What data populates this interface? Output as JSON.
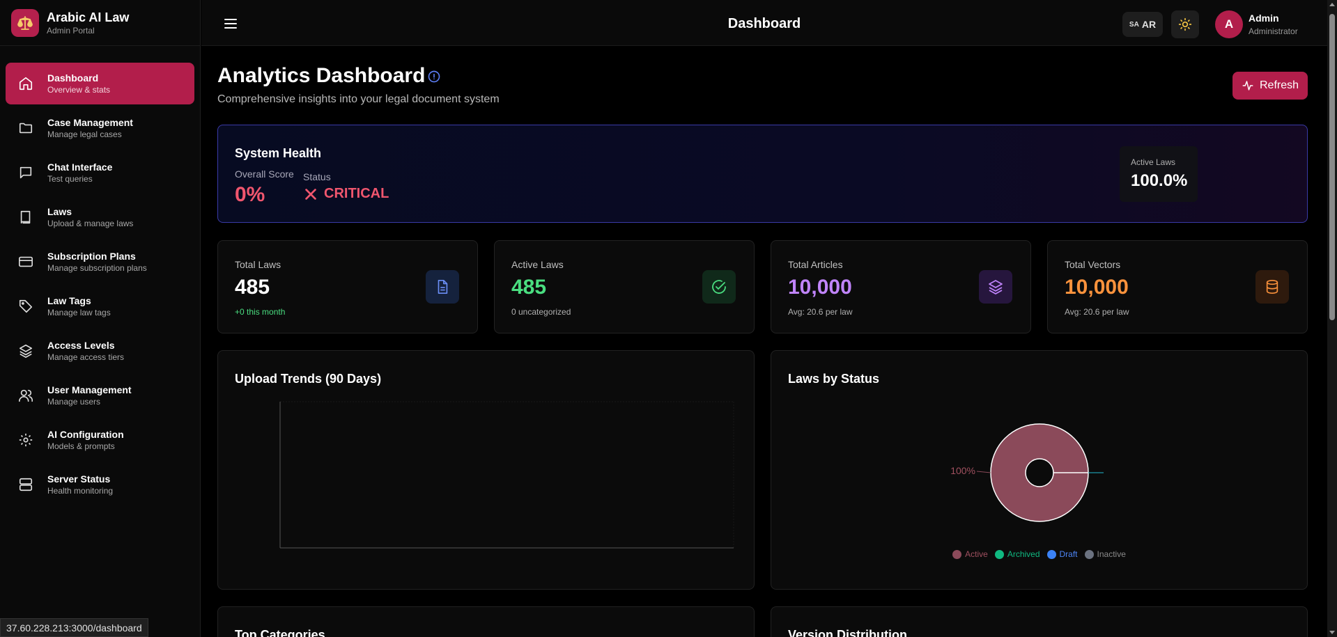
{
  "brand": {
    "title": "Arabic AI Law",
    "subtitle": "Admin Portal"
  },
  "sidebar": {
    "items": [
      {
        "label": "Dashboard",
        "desc": "Overview & stats",
        "icon": "home-icon"
      },
      {
        "label": "Case Management",
        "desc": "Manage legal cases",
        "icon": "folder-icon"
      },
      {
        "label": "Chat Interface",
        "desc": "Test queries",
        "icon": "chat-icon"
      },
      {
        "label": "Laws",
        "desc": "Upload & manage laws",
        "icon": "book-icon"
      },
      {
        "label": "Subscription Plans",
        "desc": "Manage subscription plans",
        "icon": "credit-card-icon"
      },
      {
        "label": "Law Tags",
        "desc": "Manage law tags",
        "icon": "tag-icon"
      },
      {
        "label": "Access Levels",
        "desc": "Manage access tiers",
        "icon": "layers-icon"
      },
      {
        "label": "User Management",
        "desc": "Manage users",
        "icon": "users-icon"
      },
      {
        "label": "AI Configuration",
        "desc": "Models & prompts",
        "icon": "gear-icon"
      },
      {
        "label": "Server Status",
        "desc": "Health monitoring",
        "icon": "server-icon"
      }
    ]
  },
  "topbar": {
    "title": "Dashboard",
    "lang_flag": "SA",
    "lang_code": "AR",
    "user_initial": "A",
    "user_name": "Admin",
    "user_role": "Administrator"
  },
  "main": {
    "title": "Analytics Dashboard",
    "subtitle": "Comprehensive insights into your legal document system",
    "refresh_label": "Refresh"
  },
  "health": {
    "title": "System Health",
    "score_label": "Overall Score",
    "score_value": "0%",
    "status_label": "Status",
    "status_value": "CRITICAL",
    "active_label": "Active Laws",
    "active_value": "100.0%"
  },
  "stats": [
    {
      "label": "Total Laws",
      "value": "485",
      "note": "+0 this month",
      "value_color": "#ffffff",
      "note_color": "#4ade80",
      "icon": "document-icon"
    },
    {
      "label": "Active Laws",
      "value": "485",
      "note": "0 uncategorized",
      "value_color": "#4ade80",
      "note_color": "#b0b0b0",
      "icon": "check-circle-icon"
    },
    {
      "label": "Total Articles",
      "value": "10,000",
      "note": "Avg: 20.6 per law",
      "value_color": "#c084fc",
      "note_color": "#b0b0b0",
      "icon": "layers-icon"
    },
    {
      "label": "Total Vectors",
      "value": "10,000",
      "note": "Avg: 20.6 per law",
      "value_color": "#fb923c",
      "note_color": "#b0b0b0",
      "icon": "database-icon"
    }
  ],
  "panels": {
    "upload_trends": "Upload Trends (90 Days)",
    "laws_by_status": "Laws by Status",
    "top_categories": "Top Categories",
    "version_distribution": "Version Distribution"
  },
  "chart_data": [
    {
      "type": "line",
      "title": "Upload Trends (90 Days)",
      "x": [],
      "series": []
    },
    {
      "type": "pie",
      "title": "Laws by Status",
      "categories": [
        "Active",
        "Archived",
        "Draft",
        "Inactive"
      ],
      "values": [
        100,
        0,
        0,
        0
      ],
      "colors": [
        "#8b4a5a",
        "#10b981",
        "#3b82f6",
        "#6b7280"
      ],
      "data_labels": [
        "100%"
      ],
      "legend": "bottom"
    }
  ],
  "status_bar": {
    "url": "37.60.228.213:3000/dashboard"
  },
  "colors": {
    "accent": "#b21e4b",
    "critical": "#f0566e",
    "health_border": "#3a3aa8"
  }
}
